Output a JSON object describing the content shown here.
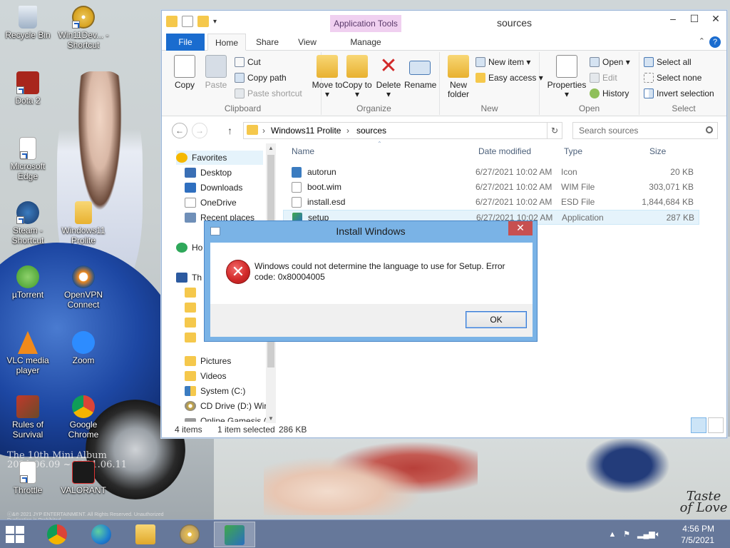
{
  "desktop": {
    "icons": [
      {
        "label": "Recycle Bin"
      },
      {
        "label": "Win11Dev... - Shortcut"
      },
      {
        "label": "Dota 2"
      },
      {
        "label": "Microsoft Edge"
      },
      {
        "label": "Steam - Shortcut"
      },
      {
        "label": "Windows11 Prolite"
      },
      {
        "label": "µTorrent"
      },
      {
        "label": "OpenVPN Connect"
      },
      {
        "label": "VLC media player"
      },
      {
        "label": "Zoom"
      },
      {
        "label": "Rules of Survival"
      },
      {
        "label": "Google Chrome"
      },
      {
        "label": "Throttle"
      },
      {
        "label": "VALORANT"
      }
    ],
    "wallpaper_caption": "The 10th Mini Album 2021.06.09 ~ 2021.06.11",
    "wallpaper_small_text": "ⓒ&℗ 2021 JYP ENTERTAINMENT. All Rights Reserved. Unauthorized Duplication is Prohibited.",
    "wallpaper_logo": "Taste of Love"
  },
  "explorer": {
    "title": "sources",
    "app_tools_label": "Application Tools",
    "tabs": {
      "file": "File",
      "home": "Home",
      "share": "Share",
      "view": "View",
      "manage": "Manage"
    },
    "ribbon": {
      "clipboard": {
        "label": "Clipboard",
        "copy": "Copy",
        "paste": "Paste",
        "cut": "Cut",
        "copy_path": "Copy path",
        "paste_shortcut": "Paste shortcut"
      },
      "organize": {
        "label": "Organize",
        "move_to": "Move to",
        "copy_to": "Copy to",
        "delete": "Delete",
        "rename": "Rename"
      },
      "new": {
        "label": "New",
        "new_folder": "New folder",
        "new_item": "New item",
        "easy_access": "Easy access"
      },
      "open": {
        "label": "Open",
        "properties": "Properties",
        "open": "Open",
        "edit": "Edit",
        "history": "History"
      },
      "select": {
        "label": "Select",
        "select_all": "Select all",
        "select_none": "Select none",
        "invert": "Invert selection"
      }
    },
    "address": {
      "crumbs": [
        "Windows11 Prolite",
        "sources"
      ]
    },
    "search": {
      "placeholder": "Search sources"
    },
    "nav": {
      "favorites": "Favorites",
      "items": [
        "Desktop",
        "Downloads",
        "OneDrive",
        "Recent places"
      ],
      "homegroup": "Ho",
      "thispc": "Th",
      "pc_items": [
        "Pictures",
        "Videos",
        "System (C:)",
        "CD Drive (D:) Wir",
        "Online Gamesjs ("
      ]
    },
    "columns": {
      "name": "Name",
      "date": "Date modified",
      "type": "Type",
      "size": "Size"
    },
    "files": [
      {
        "name": "autorun",
        "date": "6/27/2021 10:02 AM",
        "type": "Icon",
        "size": "20 KB"
      },
      {
        "name": "boot.wim",
        "date": "6/27/2021 10:02 AM",
        "type": "WIM File",
        "size": "303,071 KB"
      },
      {
        "name": "install.esd",
        "date": "6/27/2021 10:02 AM",
        "type": "ESD File",
        "size": "1,844,684 KB"
      },
      {
        "name": "setup",
        "date": "6/27/2021 10:02 AM",
        "type": "Application",
        "size": "287 KB"
      }
    ],
    "status": {
      "count": "4 items",
      "selected": "1 item selected",
      "selected_size": "286 KB"
    }
  },
  "dialog": {
    "title": "Install Windows",
    "message": "Windows could not determine the language to use for Setup. Error code: 0x80004005",
    "ok_label": "OK",
    "close_glyph": "✕",
    "icon_glyph": "✕"
  },
  "taskbar": {
    "time": "4:56 PM",
    "date": "7/5/2021"
  },
  "colors": {
    "accent": "#1a6ccf",
    "dialog_frame": "#7ab3e6",
    "selection": "#e5f3fb",
    "error_red": "#d22a2a"
  }
}
